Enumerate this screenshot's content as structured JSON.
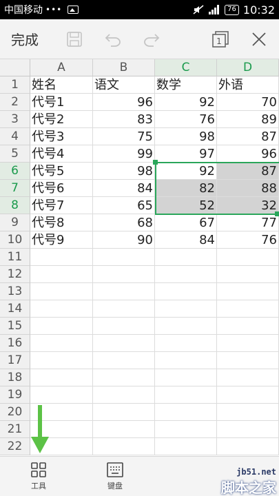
{
  "status_bar": {
    "carrier": "中国移动",
    "dots": "•••",
    "battery": "76",
    "time": "10:32"
  },
  "toolbar": {
    "done_label": "完成"
  },
  "sheet": {
    "columns": [
      "A",
      "B",
      "C",
      "D"
    ],
    "selected_columns": [
      "C",
      "D"
    ],
    "selected_rows": [
      6,
      7,
      8
    ],
    "row_numbers": [
      "1",
      "2",
      "3",
      "4",
      "5",
      "6",
      "7",
      "8",
      "9",
      "10",
      "11",
      "12",
      "13",
      "14",
      "15",
      "16",
      "17",
      "18",
      "19",
      "20",
      "21",
      "22"
    ],
    "rows": [
      [
        "姓名",
        "语文",
        "数学",
        "外语"
      ],
      [
        "代号1",
        "96",
        "92",
        "70"
      ],
      [
        "代号2",
        "83",
        "76",
        "89"
      ],
      [
        "代号3",
        "75",
        "98",
        "87"
      ],
      [
        "代号4",
        "99",
        "97",
        "96"
      ],
      [
        "代号5",
        "98",
        "92",
        "87"
      ],
      [
        "代号6",
        "84",
        "82",
        "88"
      ],
      [
        "代号7",
        "65",
        "52",
        "32"
      ],
      [
        "代号8",
        "68",
        "67",
        "77"
      ],
      [
        "代号9",
        "90",
        "84",
        "76"
      ]
    ]
  },
  "bottom_bar": {
    "tools_label": "工具",
    "keyboard_label": "键盘"
  },
  "watermark": {
    "url": "jb51.net",
    "site": "脚本之家"
  },
  "colors": {
    "selection": "#2aa65a",
    "shaded": "#d3d3d3",
    "arrow": "#5cc246"
  }
}
